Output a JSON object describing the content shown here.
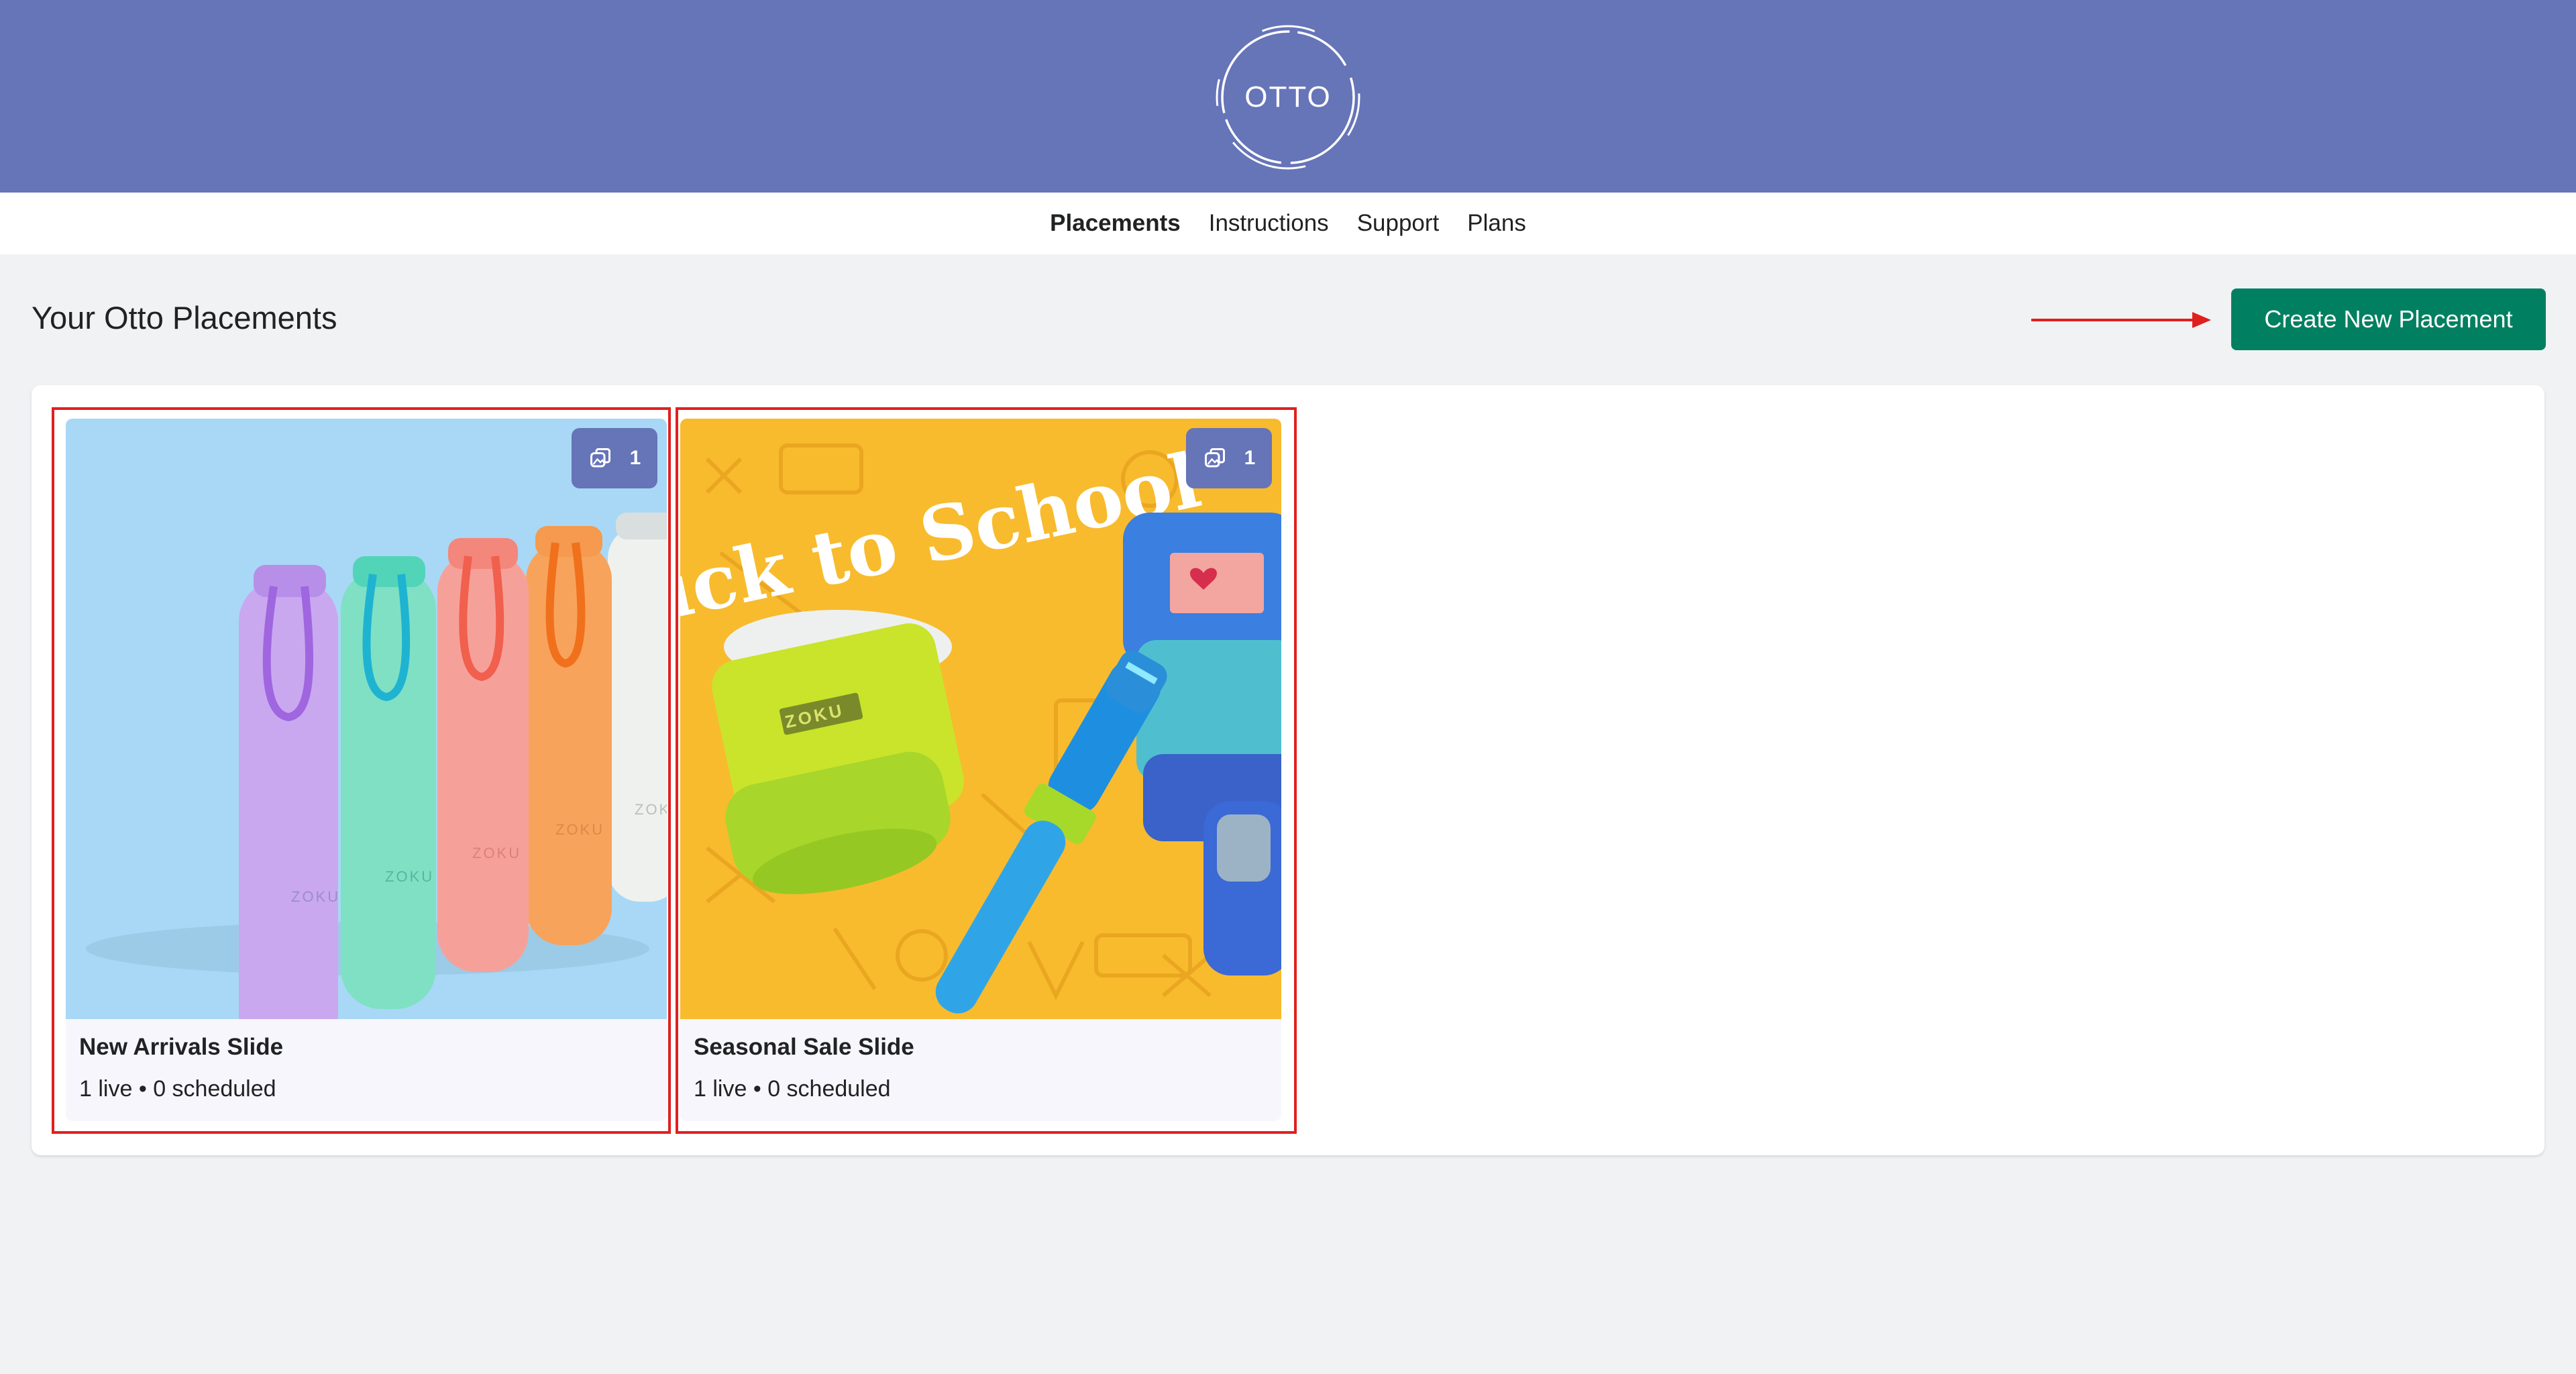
{
  "header": {
    "logo_text": "OTTO"
  },
  "nav": {
    "items": [
      {
        "label": "Placements",
        "active": true
      },
      {
        "label": "Instructions",
        "active": false
      },
      {
        "label": "Support",
        "active": false
      },
      {
        "label": "Plans",
        "active": false
      }
    ]
  },
  "page": {
    "title": "Your Otto Placements",
    "create_button": "Create New Placement"
  },
  "placements": [
    {
      "title": "New Arrivals Slide",
      "live": "1 live",
      "separator": "•",
      "scheduled": "0 scheduled",
      "slide_count": "1",
      "image_text": [
        "ZOKU",
        "ZOKU",
        "ZOKU",
        "ZOKU",
        "ZOK"
      ]
    },
    {
      "title": "Seasonal Sale Slide",
      "live": "1 live",
      "separator": "•",
      "scheduled": "0 scheduled",
      "slide_count": "1",
      "image_text": [
        "ick to School",
        "ZOKU"
      ]
    }
  ],
  "colors": {
    "header": "#6674b8",
    "button": "#008060",
    "highlight": "#e0201f",
    "background": "#f1f2f4"
  },
  "icons": [
    "logo-circle-icon",
    "slides-stack-icon",
    "red-arrow-icon"
  ]
}
